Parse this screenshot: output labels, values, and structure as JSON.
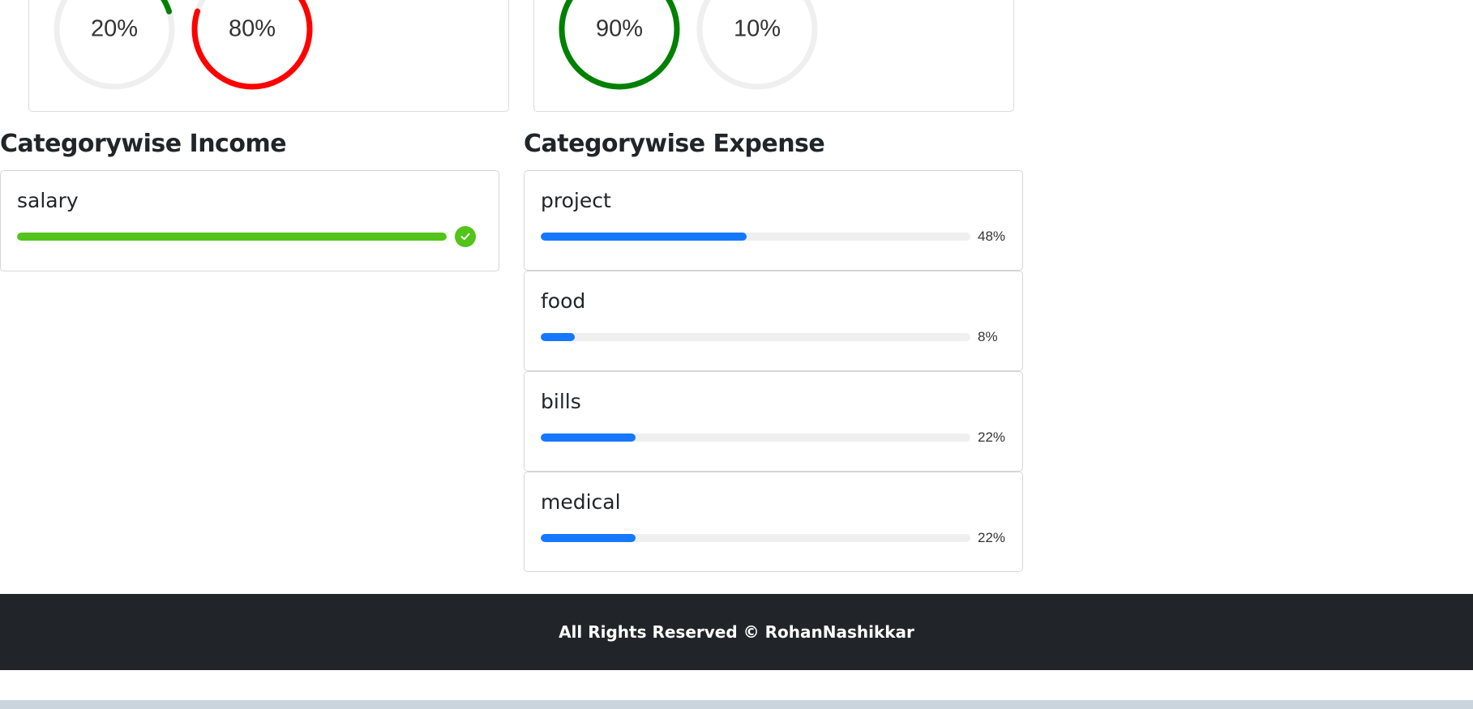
{
  "overview": {
    "income_card": {
      "rings": [
        {
          "label": "20%",
          "percent": 20,
          "color": "#008000"
        },
        {
          "label": "80%",
          "percent": 80,
          "color": "#ff0000"
        }
      ]
    },
    "expense_card": {
      "rings": [
        {
          "label": "90%",
          "percent": 90,
          "color": "#008000"
        },
        {
          "label": "10%",
          "percent": 10,
          "color": "#ff0000"
        }
      ]
    }
  },
  "income_section": {
    "title": "Categorywise Income",
    "items": [
      {
        "name": "salary",
        "percent": 100,
        "color": "#52c41a",
        "status_icon": "check-circle-icon"
      }
    ]
  },
  "expense_section": {
    "title": "Categorywise Expense",
    "items": [
      {
        "name": "project",
        "percent": 48,
        "label": "48%",
        "color": "#1677ff"
      },
      {
        "name": "food",
        "percent": 8,
        "label": "8%",
        "color": "#1677ff"
      },
      {
        "name": "bills",
        "percent": 22,
        "label": "22%",
        "color": "#1677ff"
      },
      {
        "name": "medical",
        "percent": 22,
        "label": "22%",
        "color": "#1677ff"
      }
    ]
  },
  "footer": {
    "text": "All Rights Reserved © RohanNashikkar"
  }
}
